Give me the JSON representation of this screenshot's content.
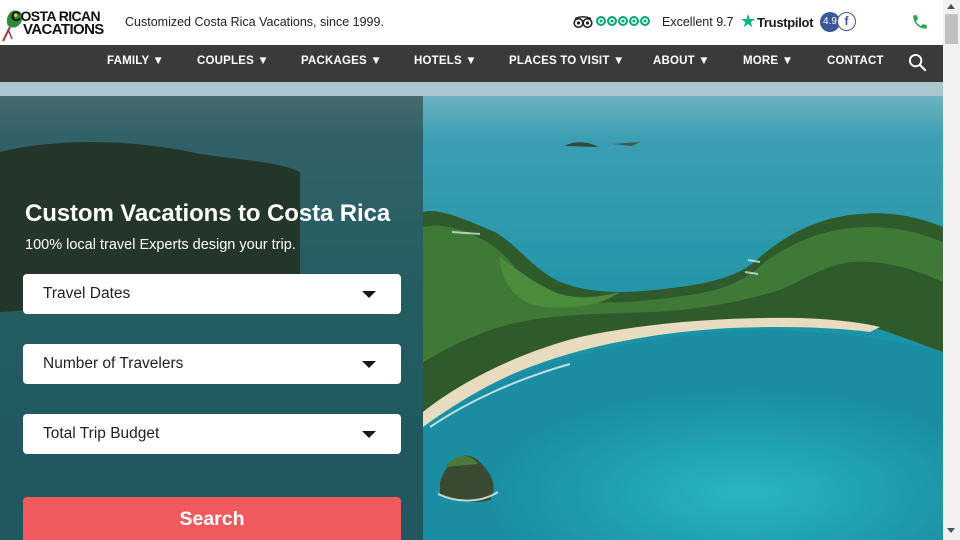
{
  "header": {
    "logo_line1": "COSTA RICAN",
    "logo_line2": "VACATIONS",
    "tagline": "Customized Costa Rica Vacations, since 1999.",
    "tripadvisor_icon": "tripadvisor-owl-icon",
    "tripadvisor_rating": 5,
    "trustpilot_label": "Excellent 9.7",
    "trustpilot_brand": "Trustpilot",
    "facebook_score": "4.9",
    "facebook_letter": "f",
    "phone_icon": "phone-icon"
  },
  "nav": {
    "items": [
      "FAMILY ▼",
      "COUPLES ▼",
      "PACKAGES ▼",
      "HOTELS ▼",
      "PLACES TO VISIT ▼",
      "ABOUT ▼",
      "MORE ▼",
      "CONTACT"
    ],
    "search_icon": "search-icon"
  },
  "hero": {
    "title": "Custom Vacations to Costa Rica",
    "subtitle": "100% local travel Experts design your trip.",
    "selects": [
      {
        "label": "Travel Dates"
      },
      {
        "label": "Number of Travelers"
      },
      {
        "label": "Total Trip Budget"
      }
    ],
    "search_label": "Search"
  },
  "colors": {
    "nav_bg": "#3a3a3a",
    "search_button": "#f05a5e",
    "tripadvisor_green": "#00aa6c",
    "trustpilot_green": "#00b67a",
    "facebook_blue": "#3b5998",
    "phone_green": "#2aa84a"
  }
}
